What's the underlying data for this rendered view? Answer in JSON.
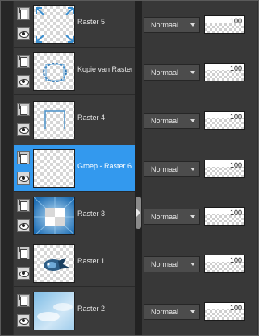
{
  "layers": [
    {
      "name": "Raster 5",
      "blend": "Normaal",
      "opacity": "100",
      "selected": false
    },
    {
      "name": "Kopie van Raster",
      "blend": "Normaal",
      "opacity": "100",
      "selected": false
    },
    {
      "name": "Raster 4",
      "blend": "Normaal",
      "opacity": "100",
      "selected": false
    },
    {
      "name": "Groep - Raster 6",
      "blend": "Normaal",
      "opacity": "100",
      "selected": true
    },
    {
      "name": "Raster 3",
      "blend": "Normaal",
      "opacity": "100",
      "selected": false
    },
    {
      "name": "Raster 1",
      "blend": "Normaal",
      "opacity": "100",
      "selected": false
    },
    {
      "name": "Raster 2",
      "blend": "Normaal",
      "opacity": "100",
      "selected": false
    }
  ],
  "colors": {
    "selection": "#3399ee",
    "panel": "#3a3a3a",
    "accent_blue": "#2e7fc4"
  }
}
